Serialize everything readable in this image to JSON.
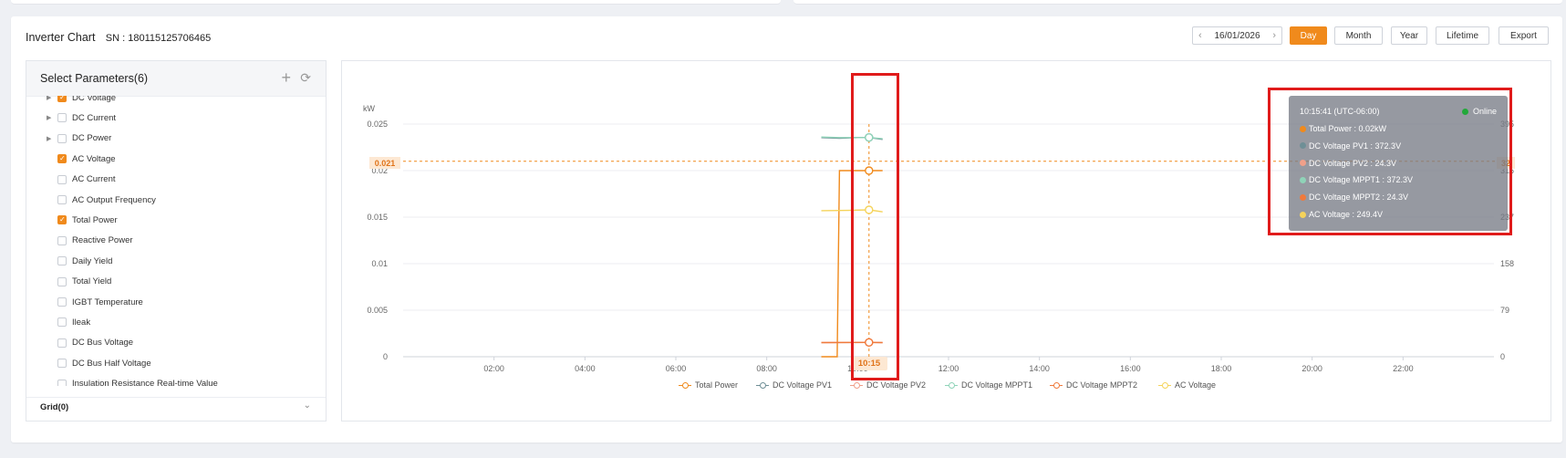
{
  "header": {
    "title": "Inverter Chart",
    "sn_label": "SN :",
    "sn_value": "180115125706465"
  },
  "toolbar": {
    "date": "16/01/2026",
    "buttons": [
      "Day",
      "Month",
      "Year",
      "Lifetime",
      "Export"
    ],
    "active": "Day"
  },
  "params": {
    "title": "Select Parameters(6)",
    "items": [
      {
        "label": "DC Voltage",
        "checked": true,
        "expandable": true
      },
      {
        "label": "DC Current",
        "checked": false,
        "expandable": true
      },
      {
        "label": "DC Power",
        "checked": false,
        "expandable": true
      },
      {
        "label": "AC Voltage",
        "checked": true,
        "expandable": false
      },
      {
        "label": "AC Current",
        "checked": false,
        "expandable": false
      },
      {
        "label": "AC Output Frequency",
        "checked": false,
        "expandable": false
      },
      {
        "label": "Total Power",
        "checked": true,
        "expandable": false
      },
      {
        "label": "Reactive Power",
        "checked": false,
        "expandable": false
      },
      {
        "label": "Daily Yield",
        "checked": false,
        "expandable": false
      },
      {
        "label": "Total Yield",
        "checked": false,
        "expandable": false
      },
      {
        "label": "IGBT Temperature",
        "checked": false,
        "expandable": false
      },
      {
        "label": "Ileak",
        "checked": false,
        "expandable": false
      },
      {
        "label": "DC Bus Voltage",
        "checked": false,
        "expandable": false
      },
      {
        "label": "DC Bus Half Voltage",
        "checked": false,
        "expandable": false
      },
      {
        "label": "Insulation Resistance Real-time Value",
        "checked": false,
        "expandable": false
      }
    ],
    "grid_label": "Grid(0)"
  },
  "tooltip": {
    "time": "10:15:41 (UTC-06:00)",
    "status": "Online",
    "status_color": "#22a83a",
    "rows": [
      {
        "label": "Total Power :",
        "value": "0.02kW",
        "color": "#f08a1c"
      },
      {
        "label": "DC Voltage PV1 :",
        "value": "372.3V",
        "color": "#6f8f96"
      },
      {
        "label": "DC Voltage PV2 :",
        "value": "24.3V",
        "color": "#f0a08a"
      },
      {
        "label": "DC Voltage MPPT1 :",
        "value": "372.3V",
        "color": "#8fd3b8"
      },
      {
        "label": "DC Voltage MPPT2 :",
        "value": "24.3V",
        "color": "#f07a3c"
      },
      {
        "label": "AC Voltage :",
        "value": "249.4V",
        "color": "#f5d35a"
      }
    ]
  },
  "cursor": {
    "x_label": "10:15",
    "y_label": "0.021",
    "right_label": "32"
  },
  "chart_data": {
    "type": "line",
    "y_unit": "kW",
    "y_ticks": [
      "0",
      "0.005",
      "0.01",
      "0.015",
      "0.02",
      "0.025"
    ],
    "y2_ticks": [
      "0",
      "79",
      "158",
      "237",
      "316",
      "395"
    ],
    "x_ticks": [
      "02:00",
      "04:00",
      "06:00",
      "08:00",
      "10:00",
      "12:00",
      "14:00",
      "16:00",
      "18:00",
      "20:00",
      "22:00"
    ],
    "ylim": [
      0,
      0.025
    ],
    "y2lim": [
      0,
      395
    ],
    "xlim_hours": [
      0,
      24
    ],
    "series": [
      {
        "name": "Total Power",
        "color": "#f08a1c",
        "axis": "left",
        "points": [
          [
            9.2,
            0
          ],
          [
            9.55,
            0
          ],
          [
            9.6,
            0.02
          ],
          [
            10.25,
            0.02
          ],
          [
            10.55,
            0.02
          ]
        ]
      },
      {
        "name": "DC Voltage PV1",
        "color": "#6f8f96",
        "axis": "right",
        "points": [
          [
            9.2,
            372
          ],
          [
            9.6,
            371
          ],
          [
            10.0,
            372
          ],
          [
            10.25,
            372.3
          ],
          [
            10.55,
            369
          ]
        ]
      },
      {
        "name": "DC Voltage PV2",
        "color": "#f0a08a",
        "axis": "right",
        "points": [
          [
            9.2,
            24
          ],
          [
            10.25,
            24.3
          ],
          [
            10.55,
            24
          ]
        ]
      },
      {
        "name": "DC Voltage MPPT1",
        "color": "#8fd3b8",
        "axis": "right",
        "points": [
          [
            9.2,
            373
          ],
          [
            9.6,
            372
          ],
          [
            10.0,
            372
          ],
          [
            10.25,
            372.3
          ],
          [
            10.55,
            370
          ]
        ]
      },
      {
        "name": "DC Voltage MPPT2",
        "color": "#f07a3c",
        "axis": "right",
        "points": [
          [
            9.2,
            24
          ],
          [
            10.25,
            24.3
          ],
          [
            10.55,
            24
          ]
        ]
      },
      {
        "name": "AC Voltage",
        "color": "#f5d35a",
        "axis": "right",
        "points": [
          [
            9.2,
            248
          ],
          [
            9.8,
            248.5
          ],
          [
            10.25,
            249.4
          ],
          [
            10.55,
            246
          ]
        ]
      }
    ],
    "cursor_hour": 10.25,
    "cursor_value": 0.021
  }
}
